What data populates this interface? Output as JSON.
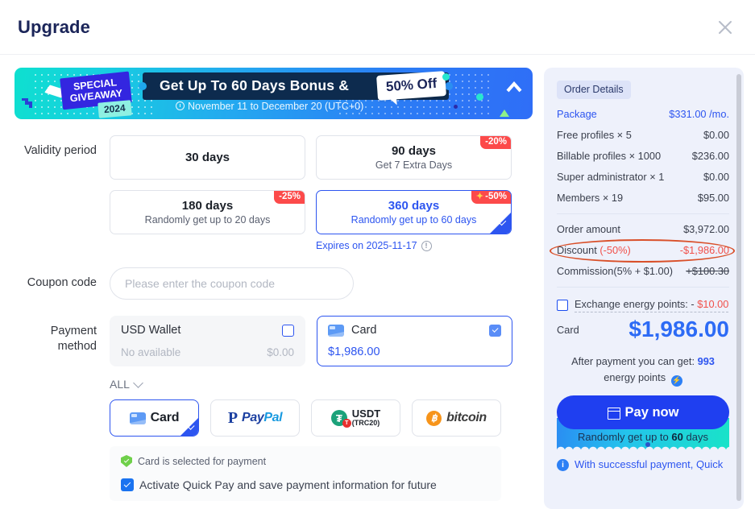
{
  "header": {
    "title": "Upgrade",
    "close_icon": "close-icon"
  },
  "banner": {
    "giveaway_line1": "SPECIAL",
    "giveaway_line2": "GIVEAWAY",
    "year": "2024",
    "headline": "Get Up To 60 Days Bonus &",
    "offer_tag": "50% Off",
    "date_range": "November 11 to December 20  (UTC+0)"
  },
  "validity": {
    "label": "Validity period",
    "options": [
      {
        "title": "30 days",
        "sub": "",
        "badge": "",
        "selected": false
      },
      {
        "title": "90 days",
        "sub": "Get 7 Extra Days",
        "badge": "-20%",
        "selected": false
      },
      {
        "title": "180 days",
        "sub": "Randomly get up to 20 days",
        "badge": "-25%",
        "selected": false
      },
      {
        "title": "360 days",
        "sub": "Randomly get up to 60 days",
        "badge": "-50%",
        "selected": true
      }
    ],
    "expires": "Expires on 2025-11-17"
  },
  "coupon": {
    "label": "Coupon code",
    "placeholder": "Please enter the coupon code",
    "value": ""
  },
  "payment": {
    "label_line1": "Payment",
    "label_line2": "method",
    "methods": [
      {
        "name": "USD Wallet",
        "status": "No available",
        "amount": "$0.00",
        "selected": false
      },
      {
        "name": "Card",
        "status": "",
        "amount": "$1,986.00",
        "selected": true
      }
    ],
    "filter_label": "ALL",
    "providers": [
      {
        "name": "Card",
        "selected": true
      },
      {
        "name": "PayPal",
        "selected": false
      },
      {
        "name": "USDT",
        "sub": "(TRC20)",
        "selected": false
      },
      {
        "name": "bitcoin",
        "selected": false
      }
    ],
    "note_selected": "Card is selected for payment",
    "note_quickpay": "Activate Quick Pay and save payment information for future"
  },
  "order": {
    "chip": "Order Details",
    "lines": [
      {
        "key": "Package",
        "value": "$331.00 /mo.",
        "highlight": true
      },
      {
        "key": "Free profiles × 5",
        "value": "$0.00",
        "highlight": false
      },
      {
        "key": "Billable profiles × 1000",
        "value": "$236.00",
        "highlight": false
      },
      {
        "key": "Super administrator × 1",
        "value": "$0.00",
        "highlight": false
      },
      {
        "key": "Members × 19",
        "value": "$95.00",
        "highlight": false
      }
    ],
    "amount_key": "Order amount",
    "amount_value": "$3,972.00",
    "discount_key": "Discount",
    "discount_pct": "(-50%)",
    "discount_value": "-$1,986.00",
    "commission_key": "Commission(5% + $1.00)",
    "commission_value": "+$100.30",
    "energy_label": "Exchange energy points: -",
    "energy_value": "$10.00",
    "total_label": "Card",
    "total_value": "$1,986.00",
    "after_payment_prefix": "After payment you can get:",
    "after_payment_points": "993",
    "after_payment_suffix": "energy points",
    "pay_button": "Pay now",
    "random_prefix": "Randomly get up to",
    "random_days": "60",
    "random_suffix": "days",
    "final_note": "With successful payment, Quick"
  },
  "colors": {
    "accent_blue": "#2d55f0",
    "pay_blue": "#1f3ff0",
    "badge_red": "#fc4a4a",
    "discount_red": "#f1504a",
    "ellipse_orange": "#d9502a",
    "panel_bg": "#eef1fb"
  }
}
